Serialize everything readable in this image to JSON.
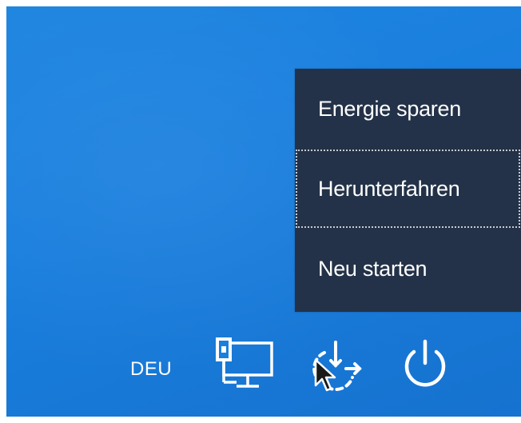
{
  "power_menu": {
    "items": [
      {
        "label": "Energie sparen",
        "icon": "sleep"
      },
      {
        "label": "Herunterfahren",
        "icon": "shut-down",
        "focused": true
      },
      {
        "label": "Neu starten",
        "icon": "restart"
      }
    ]
  },
  "tray": {
    "language": "DEU",
    "icons": [
      "network-icon",
      "ease-of-access-icon",
      "power-icon"
    ]
  },
  "colors": {
    "desktop_blue": "#1a7fde",
    "menu_background": "#233248",
    "text": "#ffffff"
  }
}
